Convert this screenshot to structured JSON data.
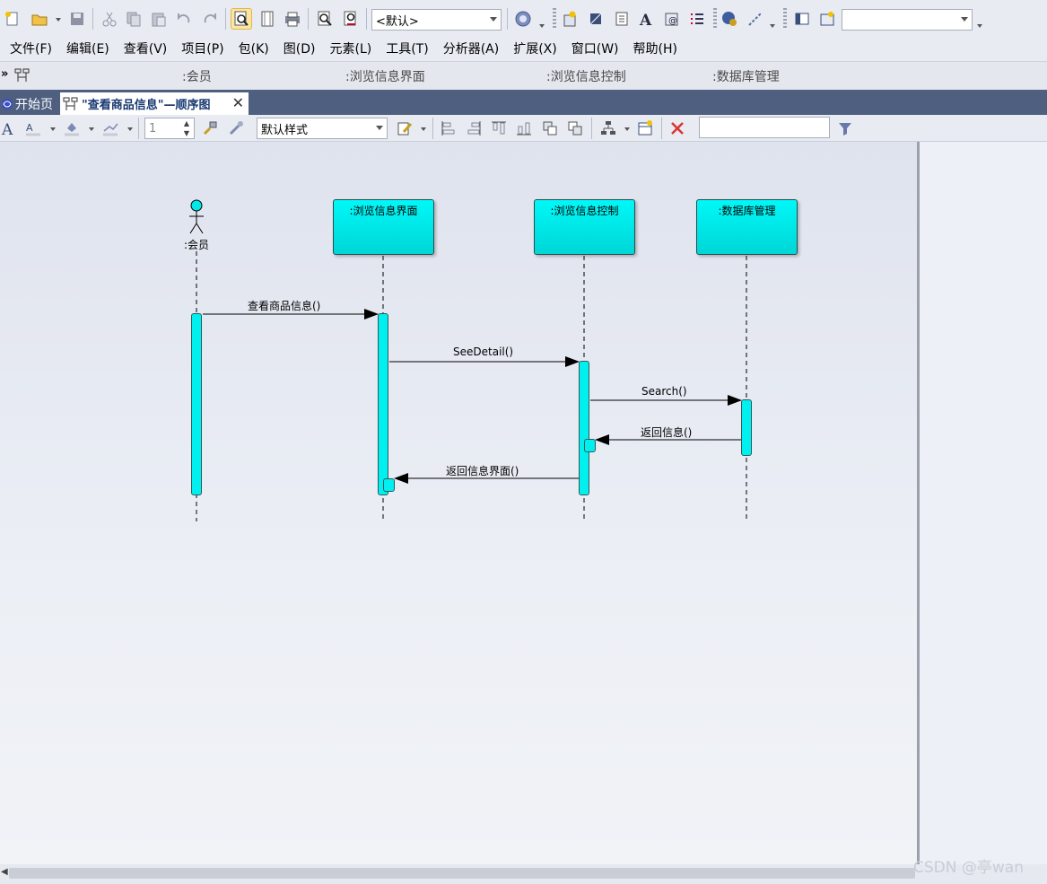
{
  "toolbar": {
    "style_combo": "<默认>",
    "empty_combo": ""
  },
  "menu": [
    "文件(F)",
    "编辑(E)",
    "查看(V)",
    "项目(P)",
    "包(K)",
    "图(D)",
    "元素(L)",
    "工具(T)",
    "分析器(A)",
    "扩展(X)",
    "窗口(W)",
    "帮助(H)"
  ],
  "lifeline_headers": [
    ":会员",
    ":浏览信息界面",
    ":浏览信息控制",
    ":数据库管理"
  ],
  "tabs": {
    "start": "开始页",
    "diagram": "\"查看商品信息\"—顺序图"
  },
  "format_toolbar": {
    "line_width": "1",
    "style": "默认样式",
    "search_value": ""
  },
  "diagram": {
    "actor": ":会员",
    "lifelines": [
      ":浏览信息界面",
      ":浏览信息控制",
      ":数据库管理"
    ],
    "messages": [
      "查看商品信息()",
      "SeeDetail()",
      "Search()",
      "返回信息()",
      "返回信息界面()"
    ]
  },
  "watermark": "CSDN @亭wan",
  "colors": {
    "lifeline_fill": "#00F0F0",
    "tab_bar": "#4F5F7F",
    "canvas": "#E4E8F0"
  }
}
